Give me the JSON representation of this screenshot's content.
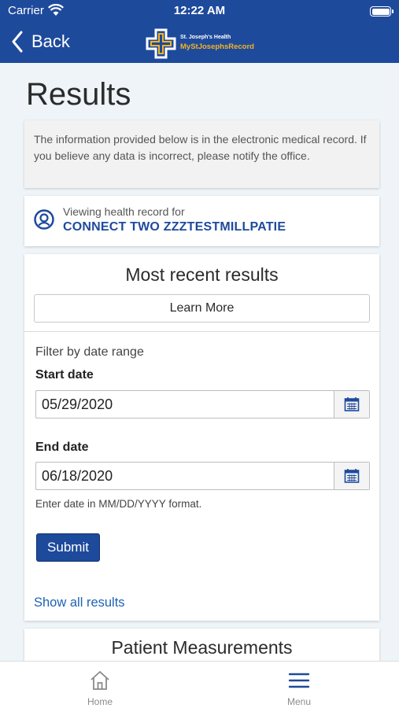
{
  "status_bar": {
    "carrier": "Carrier",
    "time": "12:22 AM"
  },
  "nav": {
    "back_label": "Back",
    "logo_line1": "St. Joseph's Health",
    "logo_line2": "MyStJosephsRecord"
  },
  "page": {
    "title": "Results"
  },
  "notice": {
    "text": "The information provided below is in the electronic medical record. If you believe any data is incorrect, please notify the office."
  },
  "viewing": {
    "label": "Viewing health record for",
    "patient_name": "CONNECT TWO ZZZTESTMILLPATIE"
  },
  "recent_results": {
    "heading": "Most recent results",
    "learn_more_label": "Learn More",
    "filter_label": "Filter by date range",
    "start_label": "Start date",
    "start_value": "05/29/2020",
    "end_label": "End date",
    "end_value": "06/18/2020",
    "format_hint": "Enter date in MM/DD/YYYY format.",
    "submit_label": "Submit",
    "show_all_label": "Show all results"
  },
  "measurements": {
    "heading": "Patient Measurements"
  },
  "tabbar": {
    "home_label": "Home",
    "menu_label": "Menu"
  },
  "colors": {
    "brand_blue": "#1e4a9c",
    "logo_gold": "#f5b323",
    "link_blue": "#1f63b5"
  }
}
